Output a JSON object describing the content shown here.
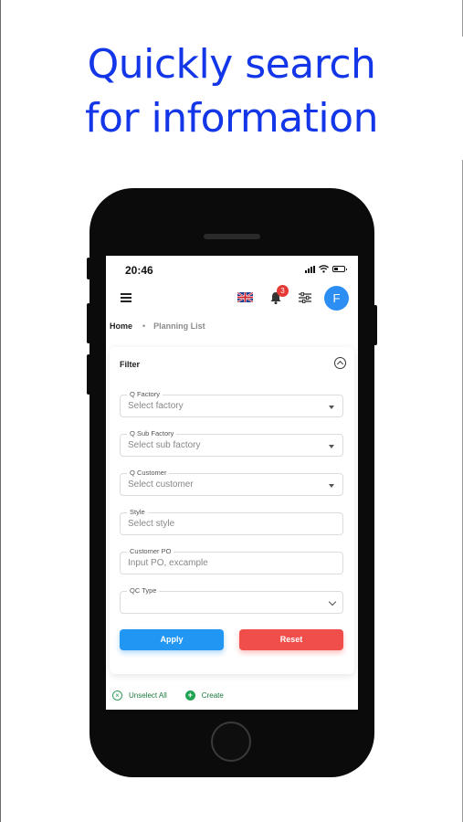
{
  "headline": {
    "line1": "Quickly search",
    "line2": "for information",
    "color": "#1336e8"
  },
  "status_bar": {
    "time": "20:46"
  },
  "app_bar": {
    "notification_count": "3",
    "avatar_initial": "F",
    "icons": [
      "menu-icon",
      "uk-flag-icon",
      "bell-icon",
      "sliders-icon"
    ]
  },
  "breadcrumb": {
    "home": "Home",
    "separator": "•",
    "current": "Planning List"
  },
  "filter": {
    "title": "Filter",
    "fields": [
      {
        "label": "Factory",
        "placeholder": "Select factory",
        "control": "dropdown",
        "search_icon": true
      },
      {
        "label": "Sub Factory",
        "placeholder": "Select sub factory",
        "control": "dropdown",
        "search_icon": true
      },
      {
        "label": "Customer",
        "placeholder": "Select customer",
        "control": "dropdown",
        "search_icon": true
      },
      {
        "label": "Style",
        "placeholder": "Select style",
        "control": "text"
      },
      {
        "label": "Customer PO",
        "placeholder": "Input PO, excample",
        "control": "text"
      },
      {
        "label": "QC Type",
        "placeholder": "",
        "control": "select"
      }
    ],
    "apply_label": "Apply",
    "reset_label": "Reset"
  },
  "bottom_actions": {
    "unselect_label": "Unselect All",
    "create_label": "Create"
  },
  "colors": {
    "apply": "#2196f3",
    "reset": "#f04e4a",
    "avatar": "#2c8ef2",
    "action_green": "#1b7a3c"
  }
}
